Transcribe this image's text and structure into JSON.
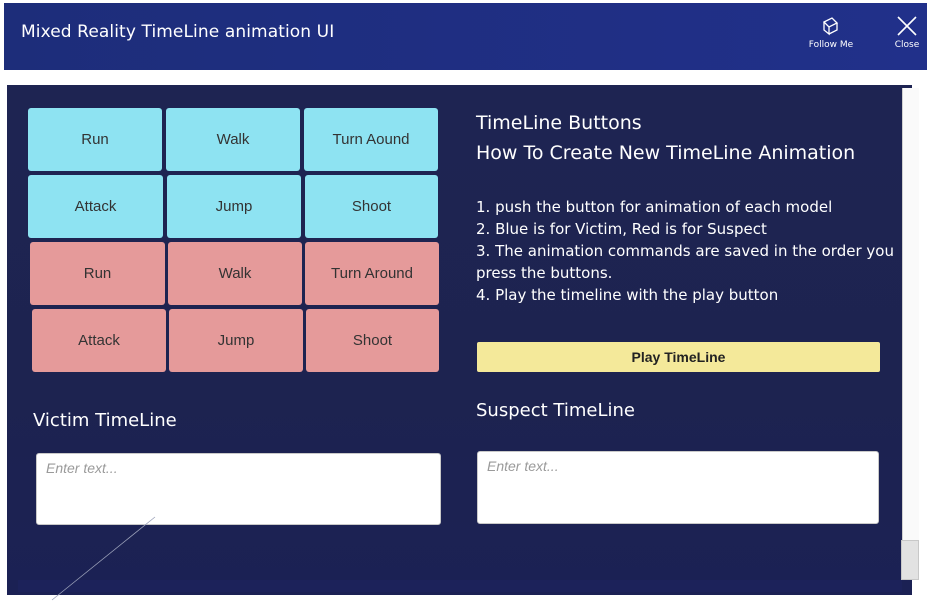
{
  "window": {
    "title": "Mixed Reality TimeLine animation UI",
    "follow_me_label": "Follow Me",
    "close_label": "Close"
  },
  "victim_buttons": [
    "Run",
    "Walk",
    "Turn Aound",
    "Attack",
    "Jump",
    "Shoot"
  ],
  "suspect_buttons": [
    "Run",
    "Walk",
    "Turn Around",
    "Attack",
    "Jump",
    "Shoot"
  ],
  "info": {
    "heading_line1": "TimeLine Buttons",
    "heading_line2": "How To Create New TimeLine Animation",
    "steps": [
      "1. push the button for animation of each model",
      "2. Blue is for Victim, Red is for Suspect",
      "3. The animation commands are saved in the order you press the buttons.",
      "4. Play the timeline with the play button"
    ],
    "play_label": "Play TimeLine"
  },
  "victim_timeline": {
    "heading": "Victim TimeLine",
    "placeholder": "Enter text..."
  },
  "suspect_timeline": {
    "heading": "Suspect TimeLine",
    "placeholder": "Enter text..."
  },
  "colors": {
    "title_bar": "#1d2d7a",
    "panel": "#1e2452",
    "victim_button": "#8ee3f2",
    "suspect_button": "#e59a9a",
    "play_button": "#f4e99a"
  }
}
